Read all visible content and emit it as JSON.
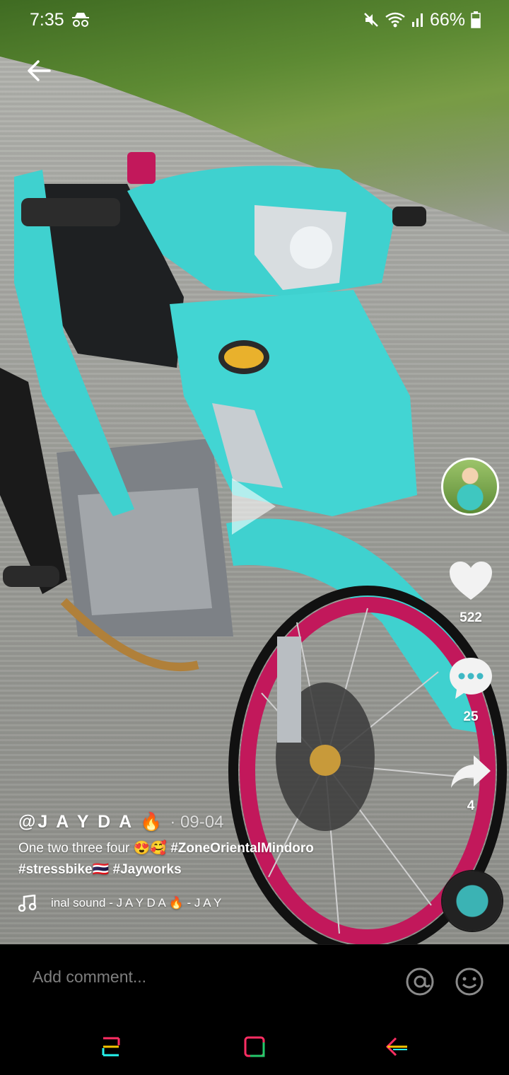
{
  "status_bar": {
    "time": "7:35",
    "battery": "66%",
    "icons": [
      "incognito-icon",
      "mute-icon",
      "wifi-icon",
      "signal-icon",
      "battery-icon"
    ]
  },
  "video": {
    "description_icons": [
      "back-arrow-icon",
      "play-icon"
    ]
  },
  "actions": {
    "likes": "522",
    "comments": "25",
    "shares": "4"
  },
  "caption": {
    "username": "@J A Y D A 🔥",
    "date": "· 09-04",
    "text": "One two three four 😍🥰 ",
    "hashtag1": "#ZoneOrientalMindoro",
    "hashtag2": "#stressbike🇹🇭",
    "hashtag3": "#Jayworks",
    "sound": "inal sound - J A Y D A 🔥 - J A Y"
  },
  "comment_bar": {
    "placeholder": "Add comment..."
  },
  "colors": {
    "accent_pink": "#ff2e63",
    "accent_teal": "#25f4ee",
    "bike_body": "#3fd1cf",
    "rim": "#c2185b"
  }
}
